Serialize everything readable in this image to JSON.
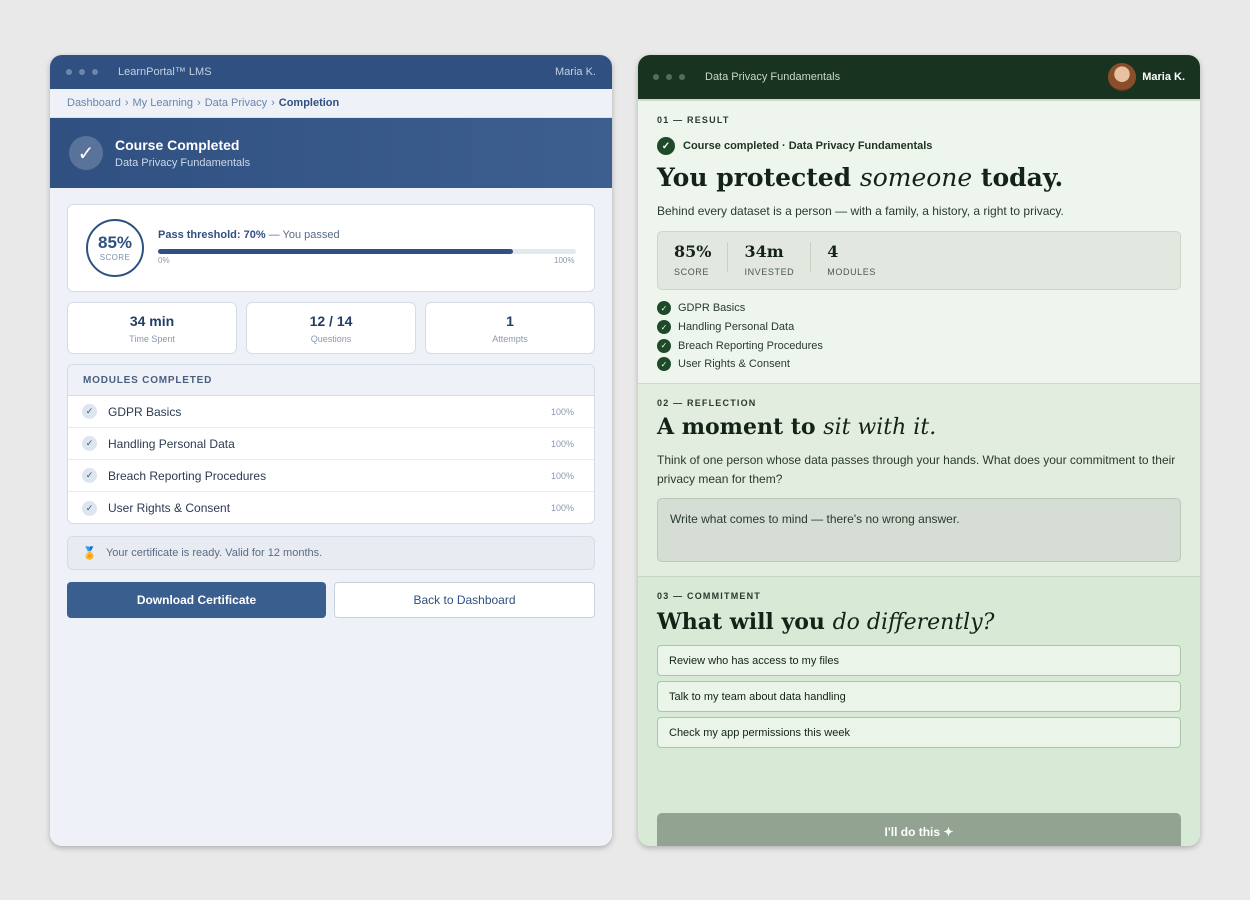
{
  "left": {
    "window_title": "LearnPortal™ LMS",
    "user": "Maria K.",
    "breadcrumb": [
      "Dashboard",
      "My Learning",
      "Data Privacy"
    ],
    "breadcrumb_current": "Completion",
    "hero": {
      "title": "Course Completed",
      "subtitle": "Data Privacy Fundamentals"
    },
    "score": {
      "value": "85%",
      "label": "SCORE",
      "progress": 0.85,
      "pass_label": "Pass threshold: 70%",
      "pass_note": "— You passed",
      "min_tick": "0%",
      "max_tick": "100%"
    },
    "stats": [
      {
        "value": "34 min",
        "label": "Time Spent"
      },
      {
        "value": "12 / 14",
        "label": "Questions"
      },
      {
        "value": "1",
        "label": "Attempts"
      }
    ],
    "modules_header": "MODULES COMPLETED",
    "modules": [
      {
        "name": "GDPR Basics",
        "pct": "100%"
      },
      {
        "name": "Handling Personal Data",
        "pct": "100%"
      },
      {
        "name": "Breach Reporting Procedures",
        "pct": "100%"
      },
      {
        "name": "User Rights & Consent",
        "pct": "100%"
      }
    ],
    "certificate": "Your certificate is ready. Valid for 12 months.",
    "download_label": "Download Certificate",
    "back_label": "Back to Dashboard"
  },
  "right": {
    "window_title": "Data Privacy Fundamentals",
    "user": "Maria K.",
    "s1": {
      "kicker": "01 — RESULT",
      "done_line": "Course completed · Data Privacy Fundamentals",
      "headline_a": "You protected ",
      "headline_em": "someone",
      "headline_b": " today.",
      "sub": "Behind every dataset is a person — with a family, a history, a right to privacy.",
      "stats": [
        {
          "value": "85%",
          "label": "SCORE"
        },
        {
          "value": "34m",
          "label": "INVESTED"
        },
        {
          "value": "4",
          "label": "MODULES"
        }
      ],
      "modules": [
        "GDPR Basics",
        "Handling Personal Data",
        "Breach Reporting Procedures",
        "User Rights & Consent"
      ]
    },
    "s2": {
      "kicker": "02 — REFLECTION",
      "headline_a": "A moment to ",
      "headline_em": "sit with it.",
      "sub": "Think of one person whose data passes through your hands. What does your commitment to their privacy mean for them?",
      "placeholder": "Write what comes to mind — there's no wrong answer."
    },
    "s3": {
      "kicker": "03 — COMMITMENT",
      "headline_a": "What will you ",
      "headline_em": "do differently?",
      "options": [
        "Review who has access to my files",
        "Talk to my team about data handling",
        "Check my app permissions this week"
      ],
      "cta": "I'll do this ✦"
    }
  }
}
